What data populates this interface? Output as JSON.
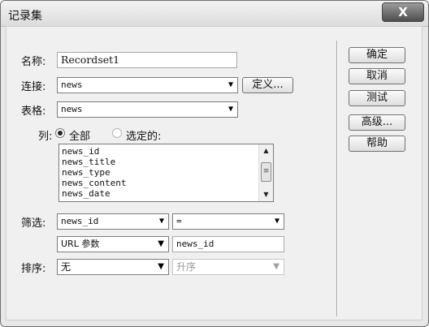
{
  "window": {
    "title": "记录集",
    "close_label": "X"
  },
  "form": {
    "name_label": "名称:",
    "name_value": "Recordset1",
    "connection_label": "连接:",
    "connection_value": "news",
    "define_button": "定义...",
    "table_label": "表格:",
    "table_value": "news",
    "columns_label": "列:",
    "columns_all": "全部",
    "columns_selected": "选定的:",
    "columns_option_selected": "全部",
    "columns_list": [
      "news_id",
      "news_title",
      "news_type",
      "news_content",
      "news_date"
    ],
    "filter_label": "筛选:",
    "filter_column": "news_id",
    "filter_operator": "=",
    "filter_source": "URL 参数",
    "filter_value": "news_id",
    "sort_label": "排序:",
    "sort_column": "无",
    "sort_order": "升序"
  },
  "buttons": {
    "ok": "确定",
    "cancel": "取消",
    "test": "测试",
    "advanced": "高级...",
    "help": "帮助"
  }
}
